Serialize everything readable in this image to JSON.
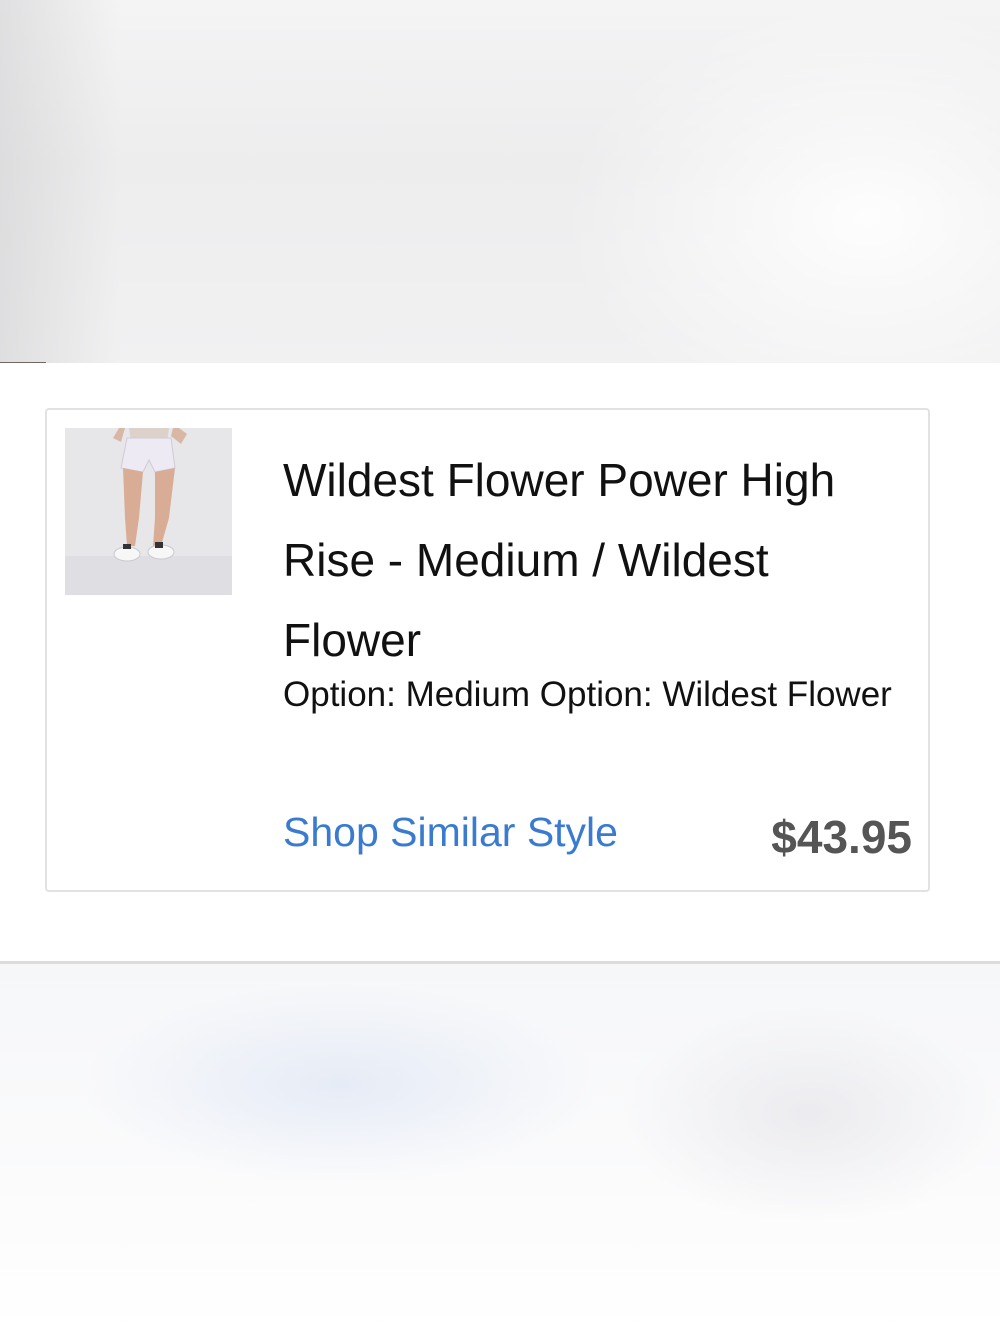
{
  "cart_item": {
    "title": "Wildest Flower Power High Rise - Medium / Wildest Flower",
    "options": "Option: Medium Option: Wildest Flower",
    "shop_similar_label": "Shop Similar Style",
    "price": "$43.95",
    "thumbnail": "product-photo-shorts"
  },
  "colors": {
    "link": "#3a7bd0",
    "price": "#555555",
    "card_border": "#e2e2e2"
  }
}
